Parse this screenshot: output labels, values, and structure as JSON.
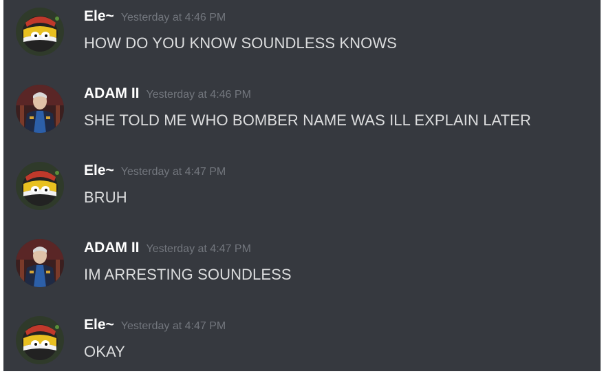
{
  "messages": [
    {
      "author": "Ele~",
      "timestamp": "Yesterday at 4:46 PM",
      "text": "HOW DO YOU KNOW SOUNDLESS KNOWS",
      "avatar": "countryball-avatar-icon"
    },
    {
      "author": "ADAM II",
      "timestamp": "Yesterday at 4:46 PM",
      "text": "SHE TOLD ME WHO BOMBER NAME WAS ILL EXPLAIN LATER",
      "avatar": "portrait-avatar-icon"
    },
    {
      "author": "Ele~",
      "timestamp": "Yesterday at 4:47 PM",
      "text": "BRUH",
      "avatar": "countryball-avatar-icon"
    },
    {
      "author": "ADAM II",
      "timestamp": "Yesterday at 4:47 PM",
      "text": "IM ARRESTING SOUNDLESS",
      "avatar": "portrait-avatar-icon"
    },
    {
      "author": "Ele~",
      "timestamp": "Yesterday at 4:47 PM",
      "text": "OKAY",
      "avatar": "countryball-avatar-icon"
    }
  ],
  "colors": {
    "background": "#36393f",
    "username": "#ffffff",
    "timestamp": "#72767d",
    "message_text": "#dcddde"
  }
}
